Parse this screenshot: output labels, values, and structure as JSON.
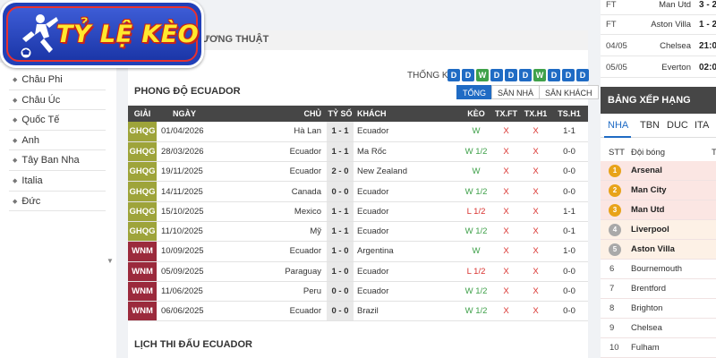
{
  "logo": {
    "text": "TỶ LỆ KÈO"
  },
  "sidebar": {
    "items": [
      "Châu Phi",
      "Châu Úc",
      "Quốc Tế",
      "Anh",
      "Tây Ban Nha",
      "Italia",
      "Đức"
    ]
  },
  "center": {
    "section_title": "ƯƠNG THUẬT",
    "stats_label": "THỐNG KÊ",
    "stats": [
      "D",
      "D",
      "W",
      "D",
      "D",
      "D",
      "W",
      "D",
      "D",
      "D"
    ],
    "stat_colors": {
      "W": "#3fa14a",
      "D": "#1f6bc4"
    },
    "filters": [
      "TỔNG",
      "SÂN NHÀ",
      "SÂN KHÁCH"
    ],
    "form_title": "PHONG ĐỘ ECUADOR",
    "headers": {
      "league": "GIẢI",
      "date": "NGÀY",
      "home": "CHỦ",
      "score": "TỶ SỐ",
      "away": "KHÁCH",
      "keo": "KÈO",
      "txft": "TX.FT",
      "txhi": "TX.H1",
      "tshi": "TS.H1"
    },
    "matches": [
      {
        "league": "GHQG",
        "date": "01/04/2026",
        "home": "Hà Lan",
        "score": "1 - 1",
        "away": "Ecuador",
        "keo": "W",
        "txft": "X",
        "txhi": "X",
        "tshi": "1-1"
      },
      {
        "league": "GHQG",
        "date": "28/03/2026",
        "home": "Ecuador",
        "score": "1 - 1",
        "away": "Ma Rốc",
        "keo": "W 1/2",
        "txft": "X",
        "txhi": "X",
        "tshi": "0-0"
      },
      {
        "league": "GHQG",
        "date": "19/11/2025",
        "home": "Ecuador",
        "score": "2 - 0",
        "away": "New Zealand",
        "keo": "W",
        "txft": "X",
        "txhi": "X",
        "tshi": "0-0"
      },
      {
        "league": "GHQG",
        "date": "14/11/2025",
        "home": "Canada",
        "score": "0 - 0",
        "away": "Ecuador",
        "keo": "W 1/2",
        "txft": "X",
        "txhi": "X",
        "tshi": "0-0"
      },
      {
        "league": "GHQG",
        "date": "15/10/2025",
        "home": "Mexico",
        "score": "1 - 1",
        "away": "Ecuador",
        "keo": "L 1/2",
        "txft": "X",
        "txhi": "X",
        "tshi": "1-1"
      },
      {
        "league": "GHQG",
        "date": "11/10/2025",
        "home": "Mỹ",
        "score": "1 - 1",
        "away": "Ecuador",
        "keo": "W 1/2",
        "txft": "X",
        "txhi": "X",
        "tshi": "0-1"
      },
      {
        "league": "WNM",
        "date": "10/09/2025",
        "home": "Ecuador",
        "score": "1 - 0",
        "away": "Argentina",
        "keo": "W",
        "txft": "X",
        "txhi": "X",
        "tshi": "1-0"
      },
      {
        "league": "WNM",
        "date": "05/09/2025",
        "home": "Paraguay",
        "score": "1 - 0",
        "away": "Ecuador",
        "keo": "L 1/2",
        "txft": "X",
        "txhi": "X",
        "tshi": "0-0"
      },
      {
        "league": "WNM",
        "date": "11/06/2025",
        "home": "Peru",
        "score": "0 - 0",
        "away": "Ecuador",
        "keo": "W 1/2",
        "txft": "X",
        "txhi": "X",
        "tshi": "0-0"
      },
      {
        "league": "WNM",
        "date": "06/06/2025",
        "home": "Ecuador",
        "score": "0 - 0",
        "away": "Brazil",
        "keo": "W 1/2",
        "txft": "X",
        "txhi": "X",
        "tshi": "0-0"
      }
    ],
    "league_colors": {
      "GHQG": "#9ea43a",
      "WNM": "#9b2a3c"
    },
    "keo_colors": {
      "W": "#3fa14a",
      "L": "#d9322f"
    },
    "schedule_title": "LỊCH THI ĐẤU ECUADOR"
  },
  "right": {
    "results": [
      {
        "status": "FT",
        "team": "Man Utd",
        "score": "3 - 2"
      },
      {
        "status": "FT",
        "team": "Aston Villa",
        "score": "1 - 2"
      },
      {
        "status": "04/05",
        "team": "Chelsea",
        "score": "21:0"
      },
      {
        "status": "05/05",
        "team": "Everton",
        "score": "02:0"
      }
    ],
    "ranking_title": "BẢNG XẾP HẠNG",
    "league_tabs": [
      "NHA",
      "TBN",
      "DUC",
      "ITA"
    ],
    "columns": {
      "stt": "STT",
      "team": "Đội bóng",
      "extra": "T"
    },
    "teams": [
      {
        "rank": "1",
        "name": "Arsenal"
      },
      {
        "rank": "2",
        "name": "Man City"
      },
      {
        "rank": "3",
        "name": "Man Utd"
      },
      {
        "rank": "4",
        "name": "Liverpool"
      },
      {
        "rank": "5",
        "name": "Aston Villa"
      },
      {
        "rank": "6",
        "name": "Bournemouth"
      },
      {
        "rank": "7",
        "name": "Brentford"
      },
      {
        "rank": "8",
        "name": "Brighton"
      },
      {
        "rank": "9",
        "name": "Chelsea"
      },
      {
        "rank": "10",
        "name": "Fulham"
      }
    ]
  }
}
